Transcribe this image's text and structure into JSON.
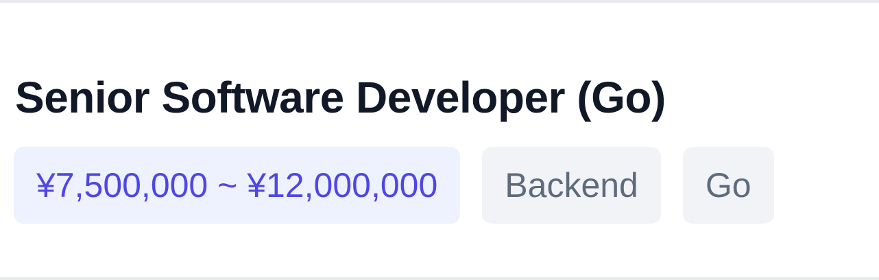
{
  "job": {
    "title": "Senior Software Developer (Go)",
    "salary": "¥7,500,000 ~ ¥12,000,000",
    "tags": [
      "Backend",
      "Go"
    ]
  },
  "colors": {
    "title_text": "#111827",
    "salary_bg": "#eef2ff",
    "salary_text": "#4f46e5",
    "tag_bg": "#f1f3f6",
    "tag_text": "#5e6b7d",
    "divider": "#e9eaee"
  }
}
